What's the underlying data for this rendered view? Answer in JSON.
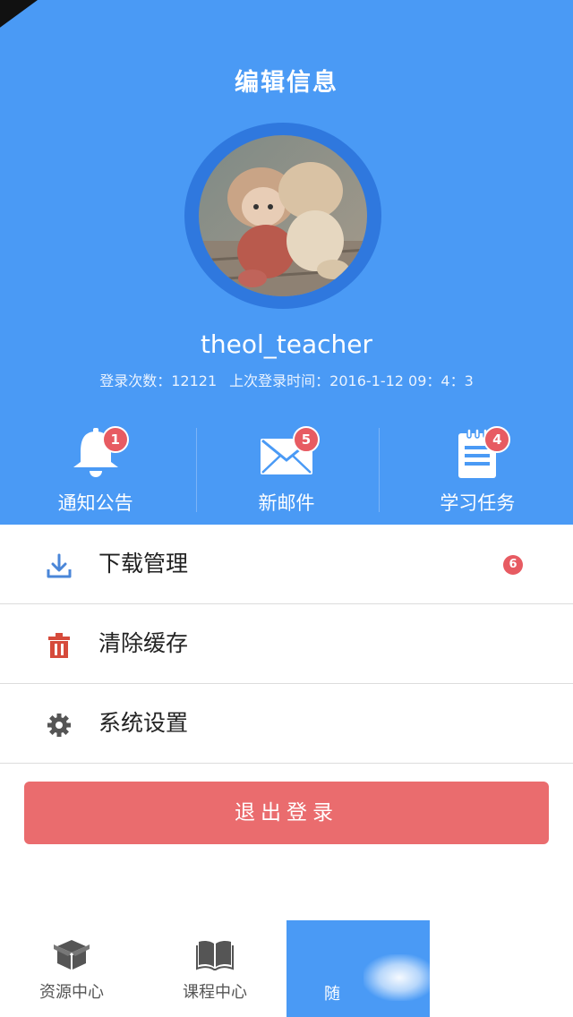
{
  "header": {
    "title": "编辑信息",
    "username": "theol_teacher",
    "login_count_label": "登录次数：",
    "login_count": "12121",
    "last_login_label": "上次登录时间：",
    "last_login_time": "2016-1-12 09：4：3"
  },
  "quick_actions": [
    {
      "label": "通知公告",
      "icon": "bell-icon",
      "badge": "1"
    },
    {
      "label": "新邮件",
      "icon": "mail-icon",
      "badge": "5"
    },
    {
      "label": "学习任务",
      "icon": "clipboard-icon",
      "badge": "4"
    }
  ],
  "menu": [
    {
      "label": "下载管理",
      "icon": "download-icon",
      "badge": "6"
    },
    {
      "label": "清除缓存",
      "icon": "trash-icon"
    },
    {
      "label": "系统设置",
      "icon": "gear-icon"
    }
  ],
  "logout_label": "退出登录",
  "tabbar": [
    {
      "label": "资源中心",
      "icon": "box-icon"
    },
    {
      "label": "课程中心",
      "icon": "book-icon"
    },
    {
      "label": "随",
      "icon": "",
      "active": true
    }
  ],
  "colors": {
    "primary": "#4a9af5",
    "ring": "#2f78de",
    "badge": "#e75b62",
    "logout": "#ea6c6e"
  }
}
